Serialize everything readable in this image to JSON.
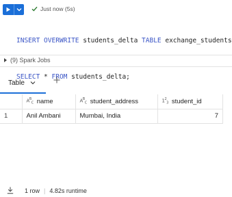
{
  "toolbar": {
    "run_icon": "play-icon",
    "dropdown_icon": "chevron-down-icon",
    "status_icon": "check-icon",
    "status_text": "Just now (5s)"
  },
  "code": {
    "line1": {
      "kw1": "INSERT OVERWRITE",
      "ident1": " students_delta ",
      "kw2": "TABLE",
      "ident2": " exchange_students;"
    },
    "line2": {
      "kw1": "SELECT",
      "op": " * ",
      "kw2": "FROM",
      "ident": " students_delta;"
    }
  },
  "spark": {
    "label": "(9) Spark Jobs"
  },
  "tabs": [
    {
      "label": "Table",
      "active": true
    }
  ],
  "table": {
    "columns": [
      {
        "name": "name",
        "type_icon": "string-type-icon"
      },
      {
        "name": "student_address",
        "type_icon": "string-type-icon"
      },
      {
        "name": "student_id",
        "type_icon": "integer-type-icon"
      }
    ],
    "rows": [
      {
        "index": "1",
        "name": "Anil Ambani",
        "student_address": "Mumbai, India",
        "student_id": "7"
      }
    ]
  },
  "footer": {
    "rows": "1 row",
    "runtime": "4.82s runtime"
  },
  "colors": {
    "accent": "#1b6fd8",
    "keyword": "#3a55c6",
    "success": "#2e7d32"
  }
}
